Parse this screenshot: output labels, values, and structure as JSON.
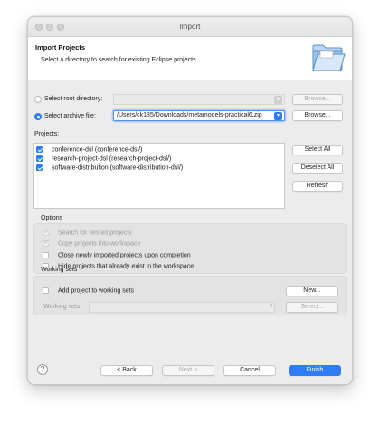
{
  "window": {
    "title": "Import"
  },
  "header": {
    "title": "Import Projects",
    "description": "Select a directory to search for existing Eclipse projects.",
    "icon": "folder-icon"
  },
  "source": {
    "root_label": "Select root directory:",
    "root_value": "",
    "root_browse": "Browse...",
    "archive_label": "Select archive file:",
    "archive_value": "/Users/ck135/Downloads/metamodels-practical6.zip",
    "archive_browse": "Browse...",
    "selected": "archive"
  },
  "projects": {
    "label": "Projects:",
    "items": [
      {
        "label": "conference-dsl (conference-dsl/)",
        "checked": true
      },
      {
        "label": "research-project-dsl (research-project-dsl/)",
        "checked": true
      },
      {
        "label": "software-distribution (software-distribution-dsl/)",
        "checked": true
      }
    ],
    "select_all": "Select All",
    "deselect_all": "Deselect All",
    "refresh": "Refresh"
  },
  "options": {
    "title": "Options",
    "items": [
      {
        "label": "Search for nested projects",
        "checked": true,
        "enabled": false
      },
      {
        "label": "Copy projects into workspace",
        "checked": true,
        "enabled": false
      },
      {
        "label": "Close newly imported projects upon completion",
        "checked": false,
        "enabled": true
      },
      {
        "label": "Hide projects that already exist in the workspace",
        "checked": false,
        "enabled": true
      }
    ]
  },
  "working_sets": {
    "title": "Working sets",
    "add_label": "Add project to working sets",
    "new_button": "New...",
    "sets_label": "Working sets:",
    "sets_value": "",
    "select_button": "Select..."
  },
  "footer": {
    "help": "?",
    "back": "< Back",
    "next": "Next >",
    "cancel": "Cancel",
    "finish": "Finish"
  },
  "colors": {
    "accent": "#2f7cf6"
  }
}
